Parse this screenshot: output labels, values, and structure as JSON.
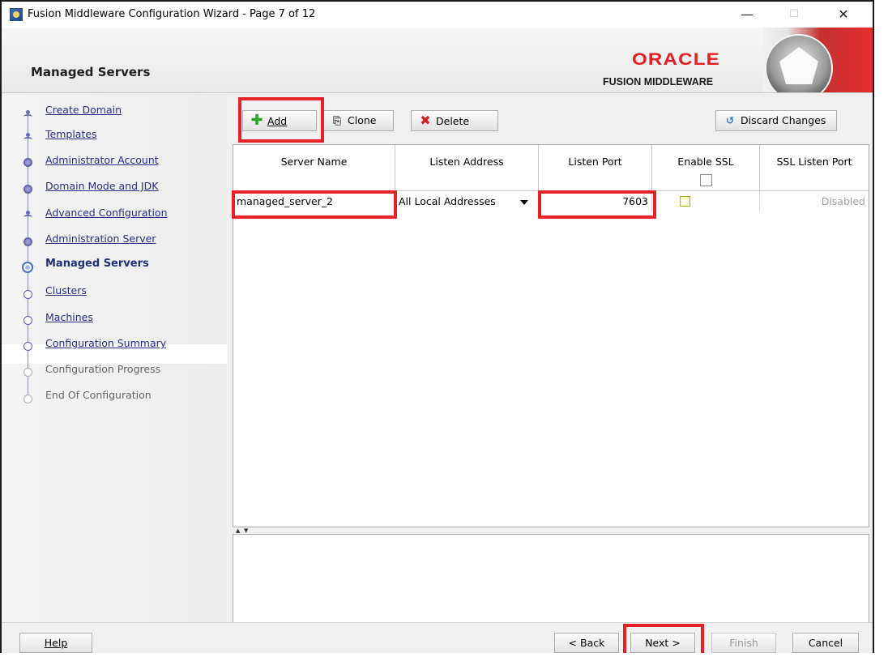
{
  "window": {
    "title": "Fusion Middleware Configuration Wizard - Page 7 of 12",
    "minimize": "—",
    "maximize": "☐",
    "close": "✕"
  },
  "header": {
    "page_title": "Managed Servers",
    "brand": "ORACLE",
    "brand_sub": "FUSION MIDDLEWARE",
    "brand_color": "#e41e26"
  },
  "nav": {
    "items": [
      {
        "label": "Create Domain",
        "state": "done"
      },
      {
        "label": "Templates",
        "state": "done"
      },
      {
        "label": "Administrator Account",
        "state": "done"
      },
      {
        "label": "Domain Mode and JDK",
        "state": "done"
      },
      {
        "label": "Advanced Configuration",
        "state": "done"
      },
      {
        "label": "Administration Server",
        "state": "done"
      },
      {
        "label": "Managed Servers",
        "state": "current"
      },
      {
        "label": "Clusters",
        "state": "todo"
      },
      {
        "label": "Machines",
        "state": "todo"
      },
      {
        "label": "Configuration Summary",
        "state": "todo"
      },
      {
        "label": "Configuration Progress",
        "state": "disabled"
      },
      {
        "label": "End Of Configuration",
        "state": "disabled"
      }
    ]
  },
  "toolbar": {
    "add": "Add",
    "clone": "Clone",
    "delete": "Delete",
    "discard": "Discard Changes"
  },
  "table": {
    "columns": [
      "Server Name",
      "Listen Address",
      "Listen Port",
      "Enable SSL",
      "SSL Listen Port"
    ],
    "rows": [
      {
        "server_name": "managed_server_2",
        "listen_address": "All Local Addresses",
        "listen_port": "7603",
        "enable_ssl": false,
        "ssl_listen_port": "Disabled"
      }
    ]
  },
  "buttons": {
    "help": "Help",
    "back": "< Back",
    "next": "Next >",
    "finish": "Finish",
    "cancel": "Cancel"
  },
  "highlight_color": "#e8202a"
}
